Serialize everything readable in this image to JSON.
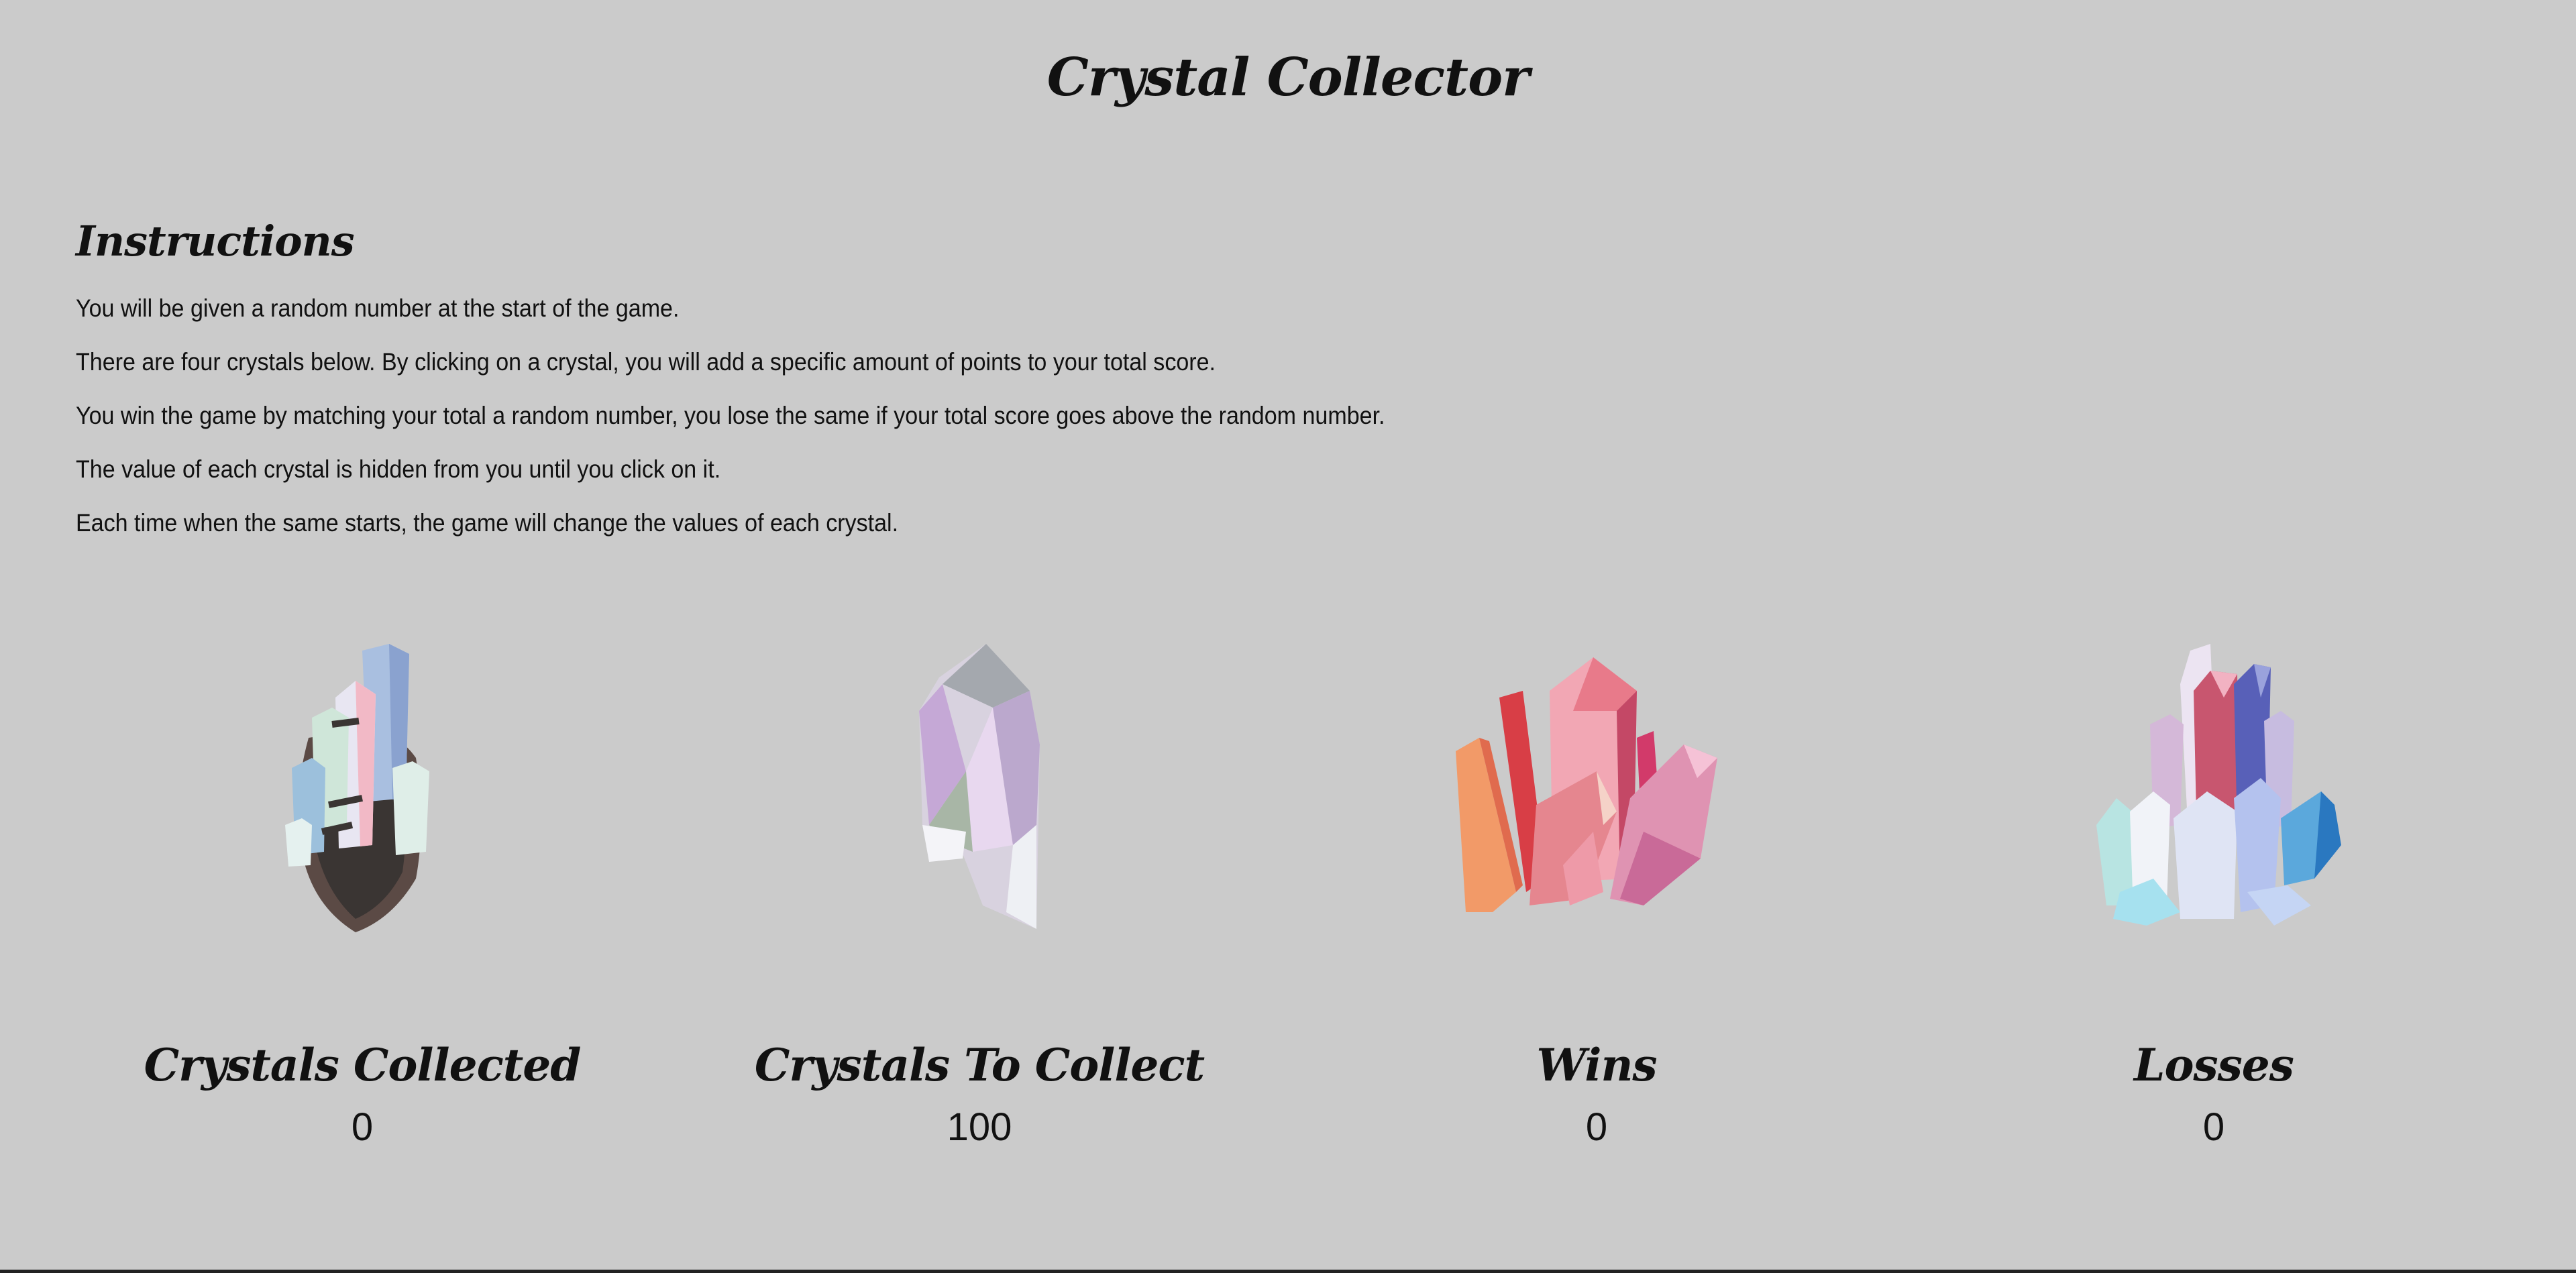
{
  "title": "Crystal Collector",
  "instructions": {
    "heading": "Instructions",
    "lines": [
      "You will be given a random number at the start of the game.",
      "There are four crystals below. By clicking on a crystal, you will add a specific amount of points to your total score.",
      "You win the game by matching your total a random number, you lose the same if your total score goes above the random number.",
      "The value of each crystal is hidden from you until you click on it.",
      "Each time when the same starts, the game will change the values of each crystal."
    ]
  },
  "crystals": [
    {
      "icon": "rock-crystal-cluster-icon"
    },
    {
      "icon": "clear-quartz-crystal-icon"
    },
    {
      "icon": "pink-crystal-cluster-icon"
    },
    {
      "icon": "pastel-crystal-cluster-icon"
    }
  ],
  "stats": {
    "collected": {
      "label": "Crystals Collected",
      "value": "0"
    },
    "to_collect": {
      "label": "Crystals To Collect",
      "value": "100"
    },
    "wins": {
      "label": "Wins",
      "value": "0"
    },
    "losses": {
      "label": "Losses",
      "value": "0"
    }
  },
  "colors": {
    "background": "#cbcbcb",
    "text": "#111111"
  }
}
